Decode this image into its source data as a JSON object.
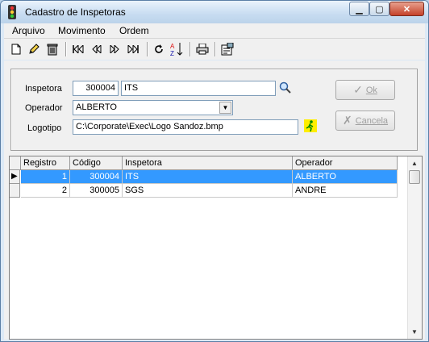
{
  "window": {
    "title": "Cadastro de Inspetoras"
  },
  "menu": [
    "Arquivo",
    "Movimento",
    "Ordem"
  ],
  "toolbar": {
    "icons": [
      "new-document-icon",
      "edit-pencil-icon",
      "delete-trash-icon",
      "first-record-icon",
      "prior-record-icon",
      "next-record-icon",
      "last-record-icon",
      "refresh-icon",
      "sort-az-icon",
      "print-icon",
      "properties-icon"
    ]
  },
  "form": {
    "inspetora_label": "Inspetora",
    "inspetora_code": "300004",
    "inspetora_name": "ITS",
    "operador_label": "Operador",
    "operador_value": "ALBERTO",
    "logotipo_label": "Logotipo",
    "logotipo_value": "C:\\Corporate\\Exec\\Logo Sandoz.bmp",
    "ok_label": "Ok",
    "cancel_label": "Cancela"
  },
  "grid": {
    "columns": [
      "Registro",
      "Código",
      "Inspetora",
      "Operador"
    ],
    "rows": [
      {
        "registro": "1",
        "codigo": "300004",
        "inspetora": "ITS",
        "operador": "ALBERTO"
      },
      {
        "registro": "2",
        "codigo": "300005",
        "inspetora": "SGS",
        "operador": "ANDRE"
      }
    ]
  },
  "colors": {
    "selection": "#3399ff",
    "accent": "#5b7fa6"
  }
}
